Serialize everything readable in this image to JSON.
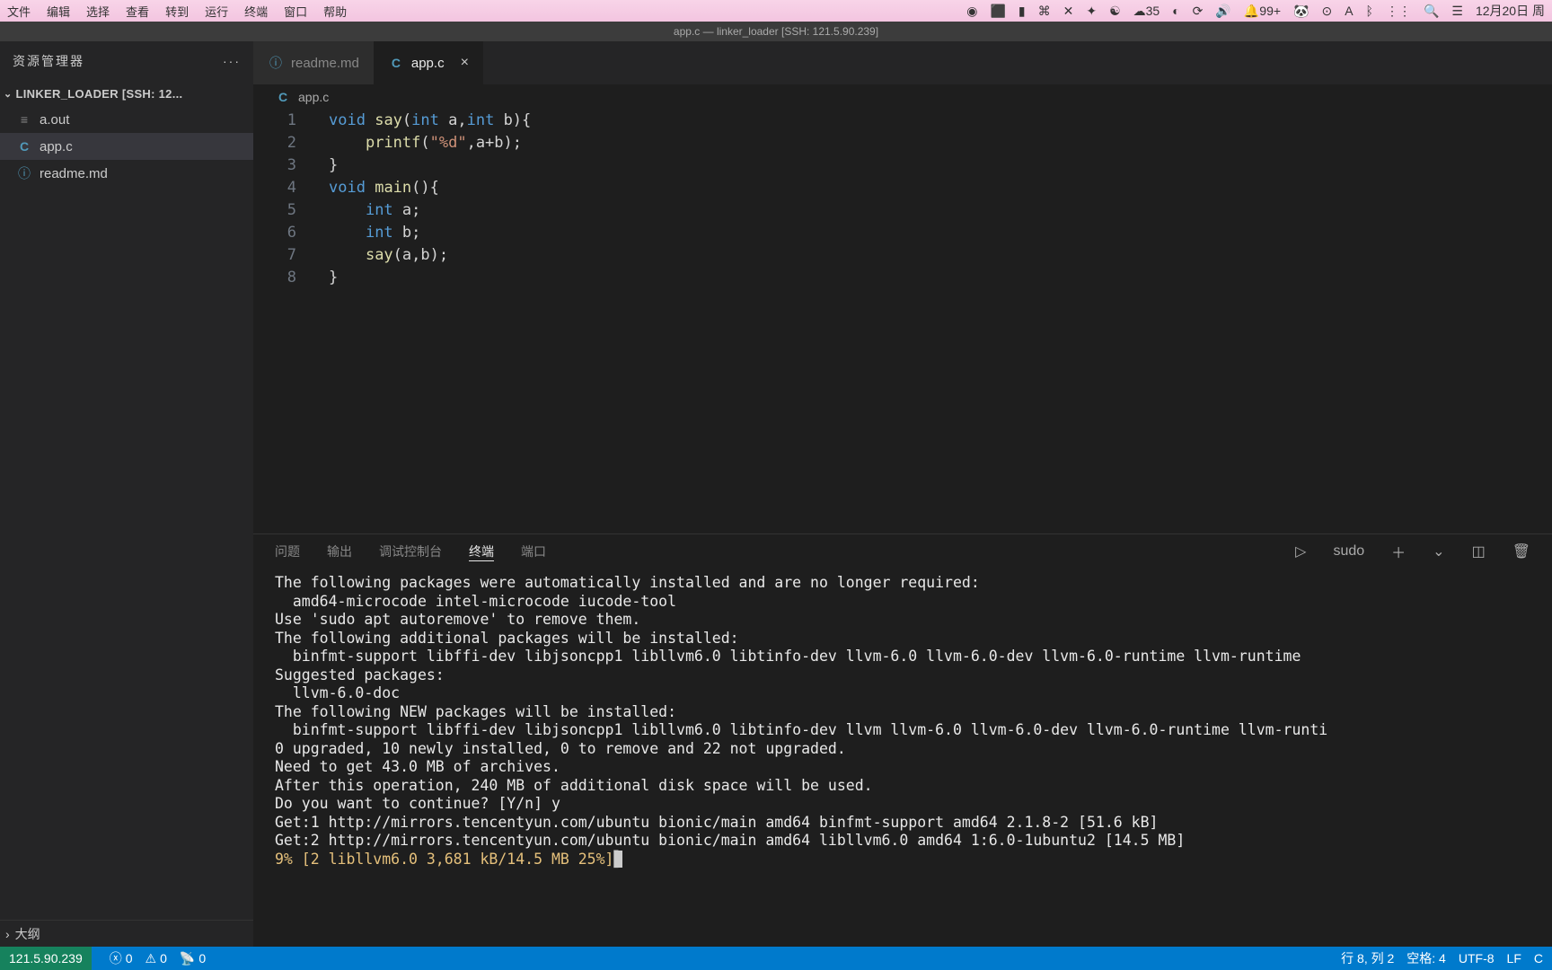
{
  "menubar": {
    "items": [
      "文件",
      "编辑",
      "选择",
      "查看",
      "转到",
      "运行",
      "终端",
      "窗口",
      "帮助"
    ],
    "right": {
      "wechat": "35",
      "notif": "99+",
      "date": "12月20日 周"
    }
  },
  "title": "app.c — linker_loader [SSH: 121.5.90.239]",
  "sidebar": {
    "title": "资源管理器",
    "folder": "LINKER_LOADER [SSH: 12...",
    "files": [
      {
        "icon": "bin",
        "name": "a.out"
      },
      {
        "icon": "c",
        "name": "app.c",
        "active": true
      },
      {
        "icon": "info",
        "name": "readme.md"
      }
    ],
    "outline": "大纲"
  },
  "tabs": [
    {
      "icon": "info",
      "name": "readme.md",
      "active": false
    },
    {
      "icon": "c",
      "name": "app.c",
      "active": true,
      "closable": true
    }
  ],
  "breadcrumb": {
    "icon": "c",
    "text": "app.c"
  },
  "code": {
    "lines": [
      {
        "n": 1,
        "html": "<span class='kw'>void</span> <span class='fn'>say</span>(<span class='kw'>int</span> a,<span class='kw'>int</span> b){"
      },
      {
        "n": 2,
        "html": "    <span class='fn'>printf</span>(<span class='str'>\"%d\"</span>,a+b);"
      },
      {
        "n": 3,
        "html": "}"
      },
      {
        "n": 4,
        "html": "<span class='kw'>void</span> <span class='fn'>main</span>(){"
      },
      {
        "n": 5,
        "html": "    <span class='kw'>int</span> a;"
      },
      {
        "n": 6,
        "html": "    <span class='kw'>int</span> b;"
      },
      {
        "n": 7,
        "html": "    <span class='fn'>say</span>(a,b);"
      },
      {
        "n": 8,
        "html": "}"
      }
    ]
  },
  "panel": {
    "tabs": [
      "问题",
      "输出",
      "调试控制台",
      "终端",
      "端口"
    ],
    "active": "终端",
    "shell": "sudo",
    "terminal_lines": [
      "The following packages were automatically installed and are no longer required:",
      "  amd64-microcode intel-microcode iucode-tool",
      "Use 'sudo apt autoremove' to remove them.",
      "The following additional packages will be installed:",
      "  binfmt-support libffi-dev libjsoncpp1 libllvm6.0 libtinfo-dev llvm-6.0 llvm-6.0-dev llvm-6.0-runtime llvm-runtime",
      "Suggested packages:",
      "  llvm-6.0-doc",
      "The following NEW packages will be installed:",
      "  binfmt-support libffi-dev libjsoncpp1 libllvm6.0 libtinfo-dev llvm llvm-6.0 llvm-6.0-dev llvm-6.0-runtime llvm-runti",
      "0 upgraded, 10 newly installed, 0 to remove and 22 not upgraded.",
      "Need to get 43.0 MB of archives.",
      "After this operation, 240 MB of additional disk space will be used.",
      "Do you want to continue? [Y/n] y",
      "Get:1 http://mirrors.tencentyun.com/ubuntu bionic/main amd64 binfmt-support amd64 2.1.8-2 [51.6 kB]",
      "Get:2 http://mirrors.tencentyun.com/ubuntu bionic/main amd64 libllvm6.0 amd64 1:6.0-1ubuntu2 [14.5 MB]"
    ],
    "progress_line": "9% [2 libllvm6.0 3,681 kB/14.5 MB 25%]"
  },
  "statusbar": {
    "host": "121.5.90.239",
    "errors": "0",
    "warnings": "0",
    "ports": "0",
    "cursor": "行 8, 列 2",
    "spaces": "空格: 4",
    "encoding": "UTF-8",
    "eol": "LF",
    "lang": "C"
  }
}
